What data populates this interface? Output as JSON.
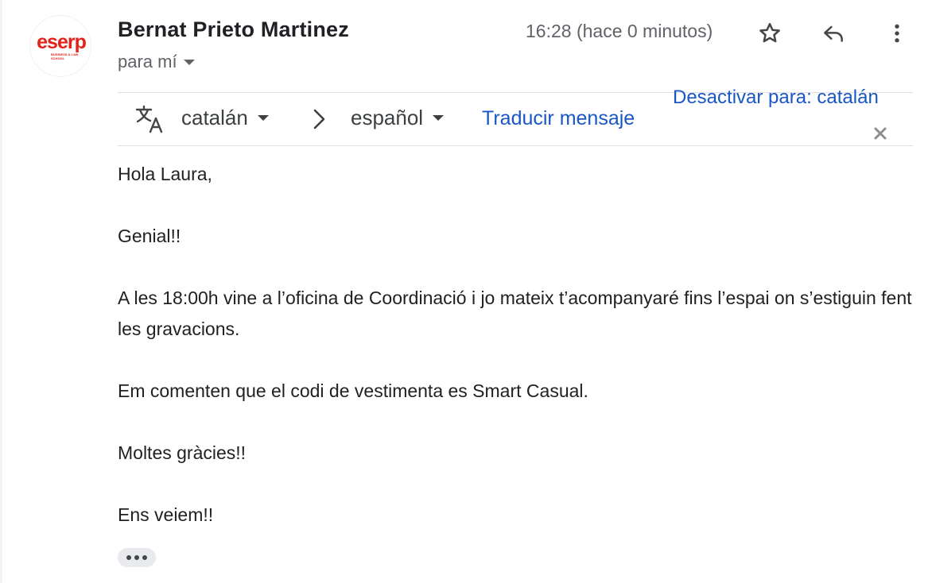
{
  "sender": {
    "name": "Bernat Prieto Martinez",
    "avatar_logo": "eserp",
    "avatar_logo_sub": "BUSINESS & LAW SCHOOL",
    "recipient_label": "para mí",
    "timestamp": "16:28 (hace 0 minutos)"
  },
  "actions": {
    "star_icon": "star-outline-icon",
    "reply_icon": "reply-icon",
    "more_icon": "more-vert-icon"
  },
  "translation_bar": {
    "source_language": "catalán",
    "target_language": "español",
    "translate_link": "Traducir mensaje",
    "disable_link": "Desactivar para: catalán",
    "colors": {
      "link": "#1a57c6"
    }
  },
  "message": {
    "greeting": "Hola Laura,",
    "line1": "Genial!!",
    "line2": "A les 18:00h vine a l’oficina de Coordinació i jo mateix t’acompanyaré fins l’espai on s’estiguin fent les gravacions.",
    "line3": "Em comenten que el codi de vestimenta es Smart Casual.",
    "line4": "Moltes gràcies!!",
    "line5": "Ens veiem!!"
  },
  "brand": {
    "accent": "#e2231a"
  }
}
